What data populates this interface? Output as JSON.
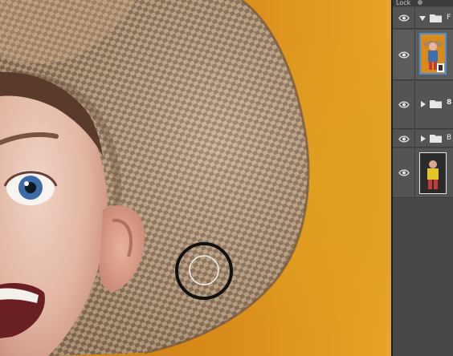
{
  "canvas": {
    "background_color": "#d88a1a",
    "brush_cursor": "circle"
  },
  "layers_panel": {
    "top_bar_label": "Lock",
    "rows": [
      {
        "type": "group",
        "expanded": true,
        "name": "F",
        "visible": true
      },
      {
        "type": "layer",
        "selected": true,
        "visible": true,
        "thumbnail": "man-in-hat-on-orange"
      },
      {
        "type": "group",
        "expanded": false,
        "name": "",
        "visible": true,
        "link_symbol": "8"
      },
      {
        "type": "group",
        "expanded": false,
        "name": "B",
        "visible": true
      },
      {
        "type": "layer",
        "selected": false,
        "visible": true,
        "thumbnail": "man-in-yellow-on-dark"
      }
    ]
  },
  "colors": {
    "panel_bg": "#4a4a4a",
    "selection_border": "#4a90d9",
    "orange_bg": "#d88a1a"
  }
}
